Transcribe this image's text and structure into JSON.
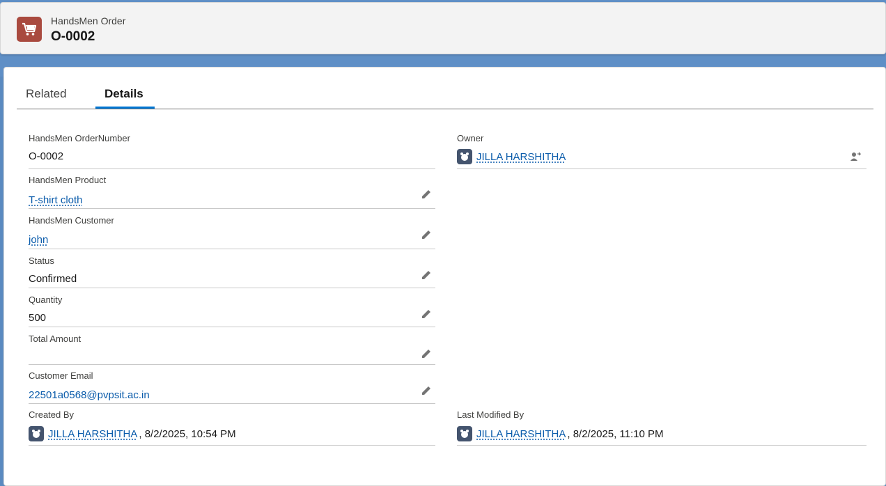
{
  "header": {
    "object_type": "HandsMen Order",
    "record_name": "O-0002",
    "icon": "cart-icon",
    "icon_color": "#a94a3f"
  },
  "tabs": [
    {
      "label": "Related",
      "active": false
    },
    {
      "label": "Details",
      "active": true
    }
  ],
  "fields": {
    "order_number": {
      "label": "HandsMen OrderNumber",
      "value": "O-0002"
    },
    "product": {
      "label": "HandsMen Product",
      "value": "T-shirt cloth"
    },
    "customer": {
      "label": "HandsMen Customer",
      "value": "john"
    },
    "status": {
      "label": "Status",
      "value": "Confirmed"
    },
    "quantity": {
      "label": "Quantity",
      "value": "500"
    },
    "total_amount": {
      "label": "Total Amount",
      "value": ""
    },
    "customer_email": {
      "label": "Customer Email",
      "value": "22501a0568@pvpsit.ac.in"
    },
    "owner": {
      "label": "Owner",
      "value": "JILLA HARSHITHA"
    },
    "created_by": {
      "label": "Created By",
      "user": "JILLA HARSHITHA",
      "date": ", 8/2/2025, 10:54 PM"
    },
    "last_modified_by": {
      "label": "Last Modified By",
      "user": "JILLA HARSHITHA",
      "date": ", 8/2/2025, 11:10 PM"
    }
  },
  "colors": {
    "link": "#0b5cab",
    "tab_active": "#0176d3"
  }
}
